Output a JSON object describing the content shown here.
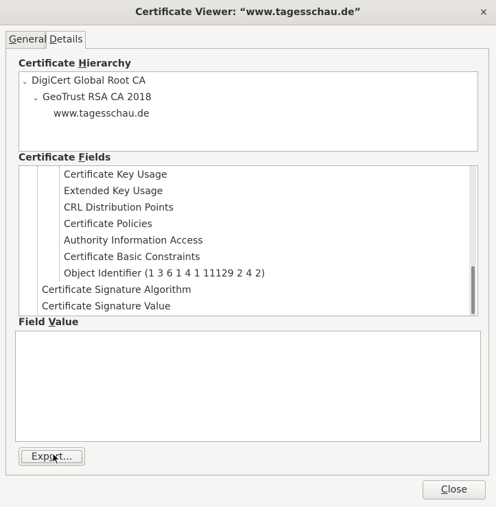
{
  "window": {
    "title": "Certificate Viewer: “www.tagesschau.de”",
    "close_glyph": "×"
  },
  "tabs": [
    {
      "label_pre": "",
      "label_u": "G",
      "label_post": "eneral"
    },
    {
      "label_pre": "",
      "label_u": "D",
      "label_post": "etails"
    }
  ],
  "hierarchy": {
    "label_pre": "Certificate ",
    "label_u": "H",
    "label_post": "ierarchy",
    "items": [
      {
        "label": "DigiCert Global Root CA",
        "expanded": true
      },
      {
        "label": "GeoTrust RSA CA 2018",
        "expanded": true
      },
      {
        "label": "www.tagesschau.de"
      }
    ]
  },
  "fields": {
    "label_pre": "Certificate ",
    "label_u": "F",
    "label_post": "ields",
    "items": [
      "Certificate Key Usage",
      "Extended Key Usage",
      "CRL Distribution Points",
      "Certificate Policies",
      "Authority Information Access",
      "Certificate Basic Constraints",
      "Object Identifier (1 3 6 1 4 1 11129 2 4 2)",
      "Certificate Signature Algorithm",
      "Certificate Signature Value"
    ]
  },
  "field_value": {
    "label_pre": "Field ",
    "label_u": "V",
    "label_post": "alue",
    "value": ""
  },
  "buttons": {
    "export_pre": "Exp",
    "export_u": "o",
    "export_post": "rt...",
    "close_u": "C",
    "close_post": "lose"
  },
  "chevron_glyph": "⌄",
  "colors": {
    "background": "#f6f5f4",
    "text": "#2e3436",
    "border": "#b6b3ae"
  }
}
